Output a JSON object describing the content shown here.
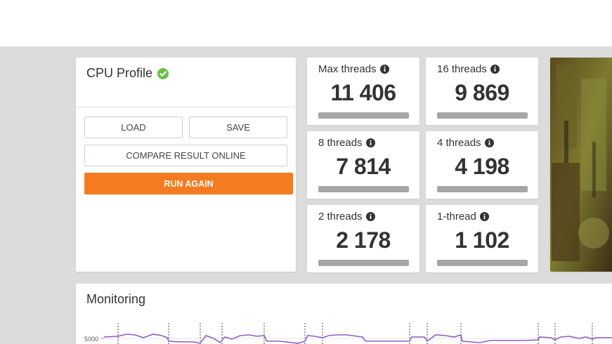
{
  "profile": {
    "title": "CPU Profile",
    "status_icon": "check-circle-icon",
    "status_color": "#6cc04a",
    "buttons": {
      "load": "LOAD",
      "save": "SAVE",
      "compare": "COMPARE RESULT ONLINE",
      "run_again": "RUN AGAIN"
    },
    "accent_color": "#f47b20"
  },
  "scores": [
    {
      "label": "Max threads",
      "value": "11 406"
    },
    {
      "label": "16 threads",
      "value": "9 869"
    },
    {
      "label": "8 threads",
      "value": "7 814"
    },
    {
      "label": "4 threads",
      "value": "4 198"
    },
    {
      "label": "2 threads",
      "value": "2 178"
    },
    {
      "label": "1-thread",
      "value": "1 102"
    }
  ],
  "monitoring": {
    "title": "Monitoring",
    "y_tick": "5000",
    "line_color": "#8e5fc4"
  }
}
